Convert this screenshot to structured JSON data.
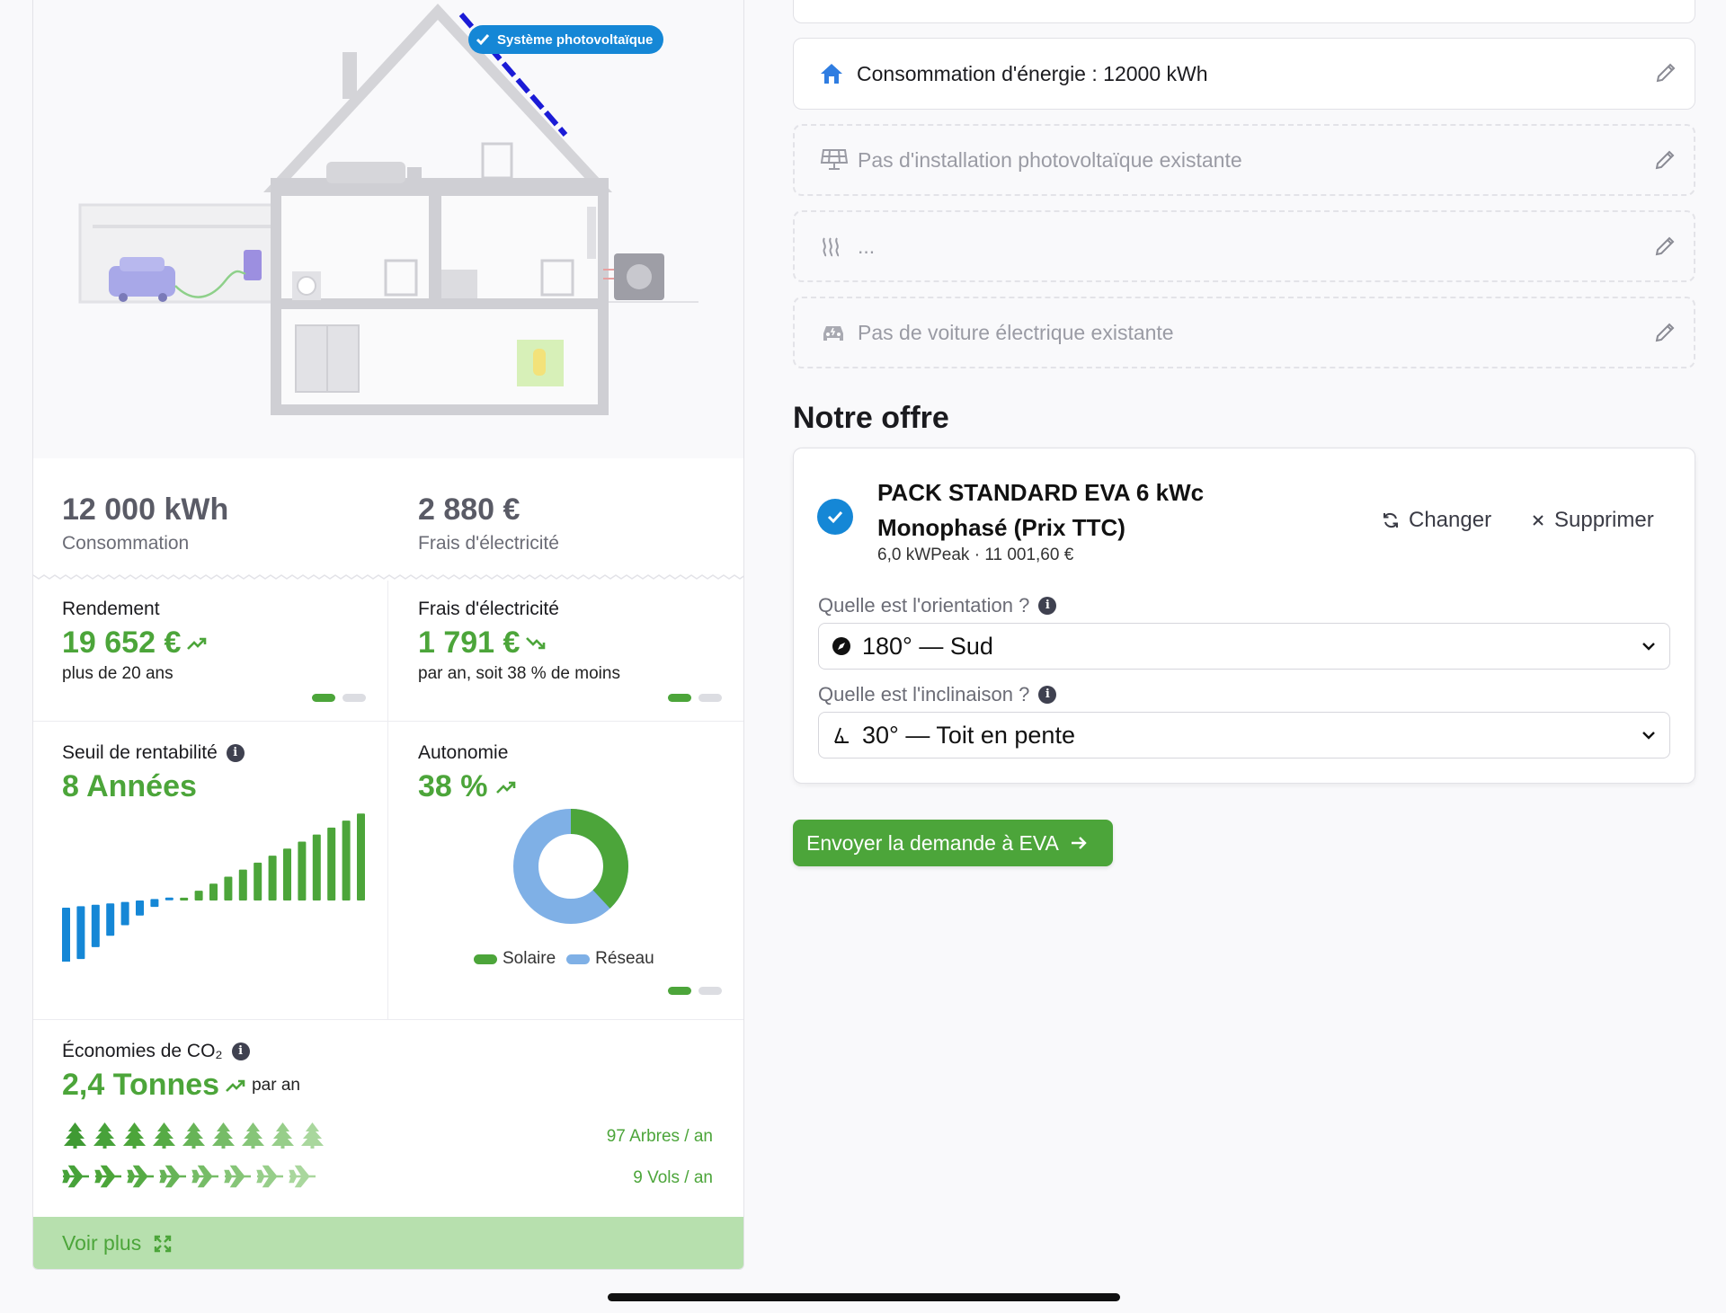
{
  "house": {
    "badge_label": "Système photovoltaïque"
  },
  "summary": {
    "consumption_value": "12 000 kWh",
    "consumption_label": "Consommation",
    "cost_value": "2 880 €",
    "cost_label": "Frais d'électricité"
  },
  "stats": {
    "yield_title": "Rendement",
    "yield_value": "19 652 €",
    "yield_sub": "plus de 20 ans",
    "elec_title": "Frais d'électricité",
    "elec_value": "1 791 €",
    "elec_sub": "par an, soit 38 % de moins",
    "breakeven_title": "Seuil de rentabilité",
    "breakeven_value": "8 Années",
    "autonomy_title": "Autonomie",
    "autonomy_value": "38 %",
    "autonomy_fraction": 0.38,
    "legend_solar": "Solaire",
    "legend_grid": "Réseau",
    "colors": {
      "green": "#4ca53a",
      "blue": "#1587d6",
      "light_blue": "#7fb0e6"
    }
  },
  "co2": {
    "title": "Économies de CO₂",
    "value": "2,4 Tonnes",
    "per": "par an",
    "trees_label": "97 Arbres / an",
    "flights_label": "9 Vols / an",
    "tree_icon": "tree-icon",
    "plane_icon": "plane-icon"
  },
  "voir_plus": "Voir plus",
  "facts": {
    "consumption": "Consommation d'énergie : 12000 kWh",
    "pv": "Pas d'installation photovoltaïque existante",
    "heating": "...",
    "ev": "Pas de voiture électrique existante"
  },
  "offer": {
    "title": "Notre offre",
    "pack_line1": "PACK STANDARD EVA 6 kWc",
    "pack_line2": "Monophasé (Prix TTC)",
    "pack_meta": "6,0 kWPeak · 11 001,60 €",
    "change_label": "Changer",
    "delete_label": "Supprimer",
    "orientation_q": "Quelle est l'orientation ?",
    "orientation_value": "180° — Sud",
    "inclination_q": "Quelle est l'inclinaison ?",
    "inclination_value": "30° — Toit en pente"
  },
  "send_button": "Envoyer la demande à EVA"
}
